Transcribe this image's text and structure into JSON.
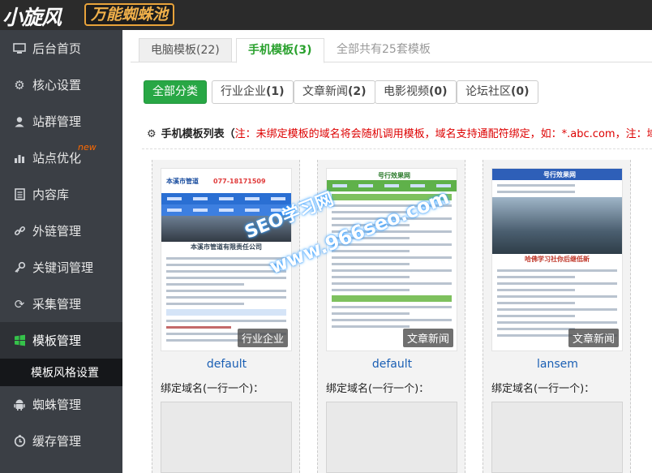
{
  "header": {
    "logo_main": "小旋风",
    "logo_sub": "万能蜘蛛池"
  },
  "sidebar": {
    "items": [
      {
        "label": "后台首页",
        "icon": "monitor-icon"
      },
      {
        "label": "核心设置",
        "icon": "gear-icon"
      },
      {
        "label": "站群管理",
        "icon": "user-icon"
      },
      {
        "label": "站点优化",
        "icon": "bar-chart-icon",
        "badge": "new"
      },
      {
        "label": "内容库",
        "icon": "document-icon"
      },
      {
        "label": "外链管理",
        "icon": "link-icon"
      },
      {
        "label": "关键词管理",
        "icon": "key-icon"
      },
      {
        "label": "采集管理",
        "icon": "refresh-icon"
      },
      {
        "label": "模板管理",
        "icon": "windows-icon"
      },
      {
        "label": "蜘蛛管理",
        "icon": "android-icon"
      },
      {
        "label": "缓存管理",
        "icon": "clock-icon"
      }
    ],
    "sub_item": "模板风格设置"
  },
  "tabs": [
    {
      "label": "电脑模板(22)"
    },
    {
      "label": "手机模板(3)"
    },
    {
      "label": "全部共有25套模板"
    }
  ],
  "filters": [
    {
      "label": "全部分类"
    },
    {
      "label": "行业企业",
      "count": "(1)"
    },
    {
      "label": "文章新闻",
      "count": "(2)"
    },
    {
      "label": "电影视频",
      "count": "(0)"
    },
    {
      "label": "论坛社区",
      "count": "(0)"
    }
  ],
  "list_title": "手机模板列表（",
  "list_note": "注：未绑定模板的域名将会随机调用模板，域名支持通配符绑定，如：*.abc.com，注：域",
  "watermark": {
    "line1": "SEO学习网",
    "line2": "www.966seo.com"
  },
  "cards": [
    {
      "category": "行业企业",
      "name": "default",
      "bind_label": "绑定域名(一行一个)：",
      "thumb_title": "本溪市管道",
      "thumb_phone": "077-18171509",
      "thumb_section": "本溪市管道有限责任公司"
    },
    {
      "category": "文章新闻",
      "name": "default",
      "bind_label": "绑定域名(一行一个)：",
      "thumb_title": "号行效果网"
    },
    {
      "category": "文章新闻",
      "name": "lansem",
      "bind_label": "绑定域名(一行一个)：",
      "thumb_title": "号行效果网",
      "thumb_headline": "哈佛学习社你后继低新"
    }
  ]
}
